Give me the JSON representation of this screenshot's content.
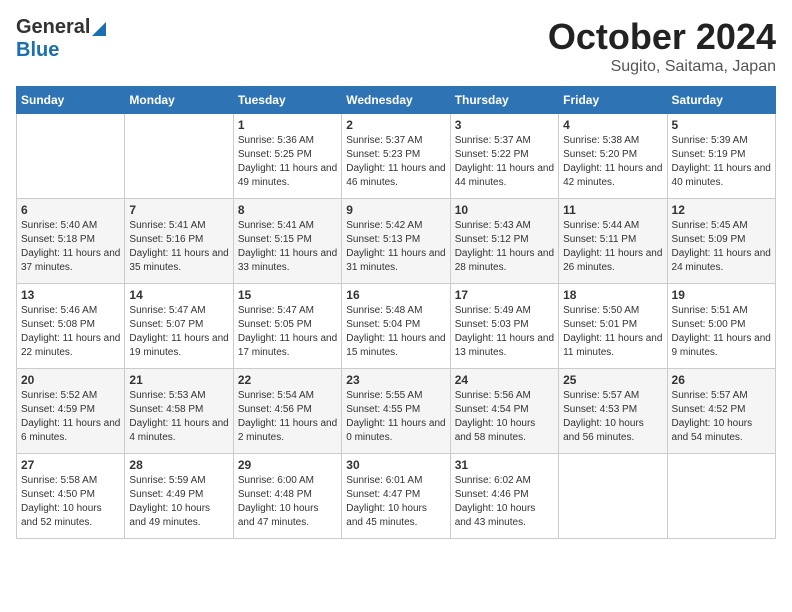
{
  "header": {
    "logo_general": "General",
    "logo_blue": "Blue",
    "month": "October 2024",
    "location": "Sugito, Saitama, Japan"
  },
  "days_of_week": [
    "Sunday",
    "Monday",
    "Tuesday",
    "Wednesday",
    "Thursday",
    "Friday",
    "Saturday"
  ],
  "weeks": [
    [
      {
        "day": "",
        "detail": ""
      },
      {
        "day": "",
        "detail": ""
      },
      {
        "day": "1",
        "detail": "Sunrise: 5:36 AM\nSunset: 5:25 PM\nDaylight: 11 hours and 49 minutes."
      },
      {
        "day": "2",
        "detail": "Sunrise: 5:37 AM\nSunset: 5:23 PM\nDaylight: 11 hours and 46 minutes."
      },
      {
        "day": "3",
        "detail": "Sunrise: 5:37 AM\nSunset: 5:22 PM\nDaylight: 11 hours and 44 minutes."
      },
      {
        "day": "4",
        "detail": "Sunrise: 5:38 AM\nSunset: 5:20 PM\nDaylight: 11 hours and 42 minutes."
      },
      {
        "day": "5",
        "detail": "Sunrise: 5:39 AM\nSunset: 5:19 PM\nDaylight: 11 hours and 40 minutes."
      }
    ],
    [
      {
        "day": "6",
        "detail": "Sunrise: 5:40 AM\nSunset: 5:18 PM\nDaylight: 11 hours and 37 minutes."
      },
      {
        "day": "7",
        "detail": "Sunrise: 5:41 AM\nSunset: 5:16 PM\nDaylight: 11 hours and 35 minutes."
      },
      {
        "day": "8",
        "detail": "Sunrise: 5:41 AM\nSunset: 5:15 PM\nDaylight: 11 hours and 33 minutes."
      },
      {
        "day": "9",
        "detail": "Sunrise: 5:42 AM\nSunset: 5:13 PM\nDaylight: 11 hours and 31 minutes."
      },
      {
        "day": "10",
        "detail": "Sunrise: 5:43 AM\nSunset: 5:12 PM\nDaylight: 11 hours and 28 minutes."
      },
      {
        "day": "11",
        "detail": "Sunrise: 5:44 AM\nSunset: 5:11 PM\nDaylight: 11 hours and 26 minutes."
      },
      {
        "day": "12",
        "detail": "Sunrise: 5:45 AM\nSunset: 5:09 PM\nDaylight: 11 hours and 24 minutes."
      }
    ],
    [
      {
        "day": "13",
        "detail": "Sunrise: 5:46 AM\nSunset: 5:08 PM\nDaylight: 11 hours and 22 minutes."
      },
      {
        "day": "14",
        "detail": "Sunrise: 5:47 AM\nSunset: 5:07 PM\nDaylight: 11 hours and 19 minutes."
      },
      {
        "day": "15",
        "detail": "Sunrise: 5:47 AM\nSunset: 5:05 PM\nDaylight: 11 hours and 17 minutes."
      },
      {
        "day": "16",
        "detail": "Sunrise: 5:48 AM\nSunset: 5:04 PM\nDaylight: 11 hours and 15 minutes."
      },
      {
        "day": "17",
        "detail": "Sunrise: 5:49 AM\nSunset: 5:03 PM\nDaylight: 11 hours and 13 minutes."
      },
      {
        "day": "18",
        "detail": "Sunrise: 5:50 AM\nSunset: 5:01 PM\nDaylight: 11 hours and 11 minutes."
      },
      {
        "day": "19",
        "detail": "Sunrise: 5:51 AM\nSunset: 5:00 PM\nDaylight: 11 hours and 9 minutes."
      }
    ],
    [
      {
        "day": "20",
        "detail": "Sunrise: 5:52 AM\nSunset: 4:59 PM\nDaylight: 11 hours and 6 minutes."
      },
      {
        "day": "21",
        "detail": "Sunrise: 5:53 AM\nSunset: 4:58 PM\nDaylight: 11 hours and 4 minutes."
      },
      {
        "day": "22",
        "detail": "Sunrise: 5:54 AM\nSunset: 4:56 PM\nDaylight: 11 hours and 2 minutes."
      },
      {
        "day": "23",
        "detail": "Sunrise: 5:55 AM\nSunset: 4:55 PM\nDaylight: 11 hours and 0 minutes."
      },
      {
        "day": "24",
        "detail": "Sunrise: 5:56 AM\nSunset: 4:54 PM\nDaylight: 10 hours and 58 minutes."
      },
      {
        "day": "25",
        "detail": "Sunrise: 5:57 AM\nSunset: 4:53 PM\nDaylight: 10 hours and 56 minutes."
      },
      {
        "day": "26",
        "detail": "Sunrise: 5:57 AM\nSunset: 4:52 PM\nDaylight: 10 hours and 54 minutes."
      }
    ],
    [
      {
        "day": "27",
        "detail": "Sunrise: 5:58 AM\nSunset: 4:50 PM\nDaylight: 10 hours and 52 minutes."
      },
      {
        "day": "28",
        "detail": "Sunrise: 5:59 AM\nSunset: 4:49 PM\nDaylight: 10 hours and 49 minutes."
      },
      {
        "day": "29",
        "detail": "Sunrise: 6:00 AM\nSunset: 4:48 PM\nDaylight: 10 hours and 47 minutes."
      },
      {
        "day": "30",
        "detail": "Sunrise: 6:01 AM\nSunset: 4:47 PM\nDaylight: 10 hours and 45 minutes."
      },
      {
        "day": "31",
        "detail": "Sunrise: 6:02 AM\nSunset: 4:46 PM\nDaylight: 10 hours and 43 minutes."
      },
      {
        "day": "",
        "detail": ""
      },
      {
        "day": "",
        "detail": ""
      }
    ]
  ]
}
